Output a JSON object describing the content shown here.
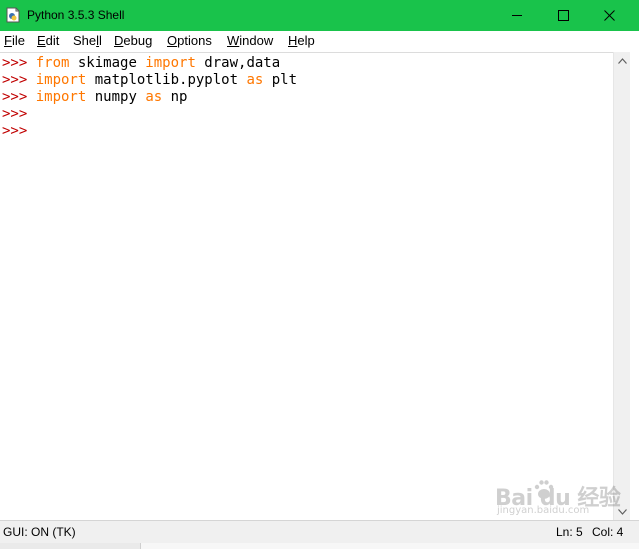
{
  "window": {
    "title": "Python 3.5.3 Shell",
    "titlebar_color": "#19c34b",
    "icon": "python-idle-icon",
    "controls": [
      "minimize-icon",
      "maximize-icon",
      "close-icon"
    ]
  },
  "menu": {
    "items": [
      {
        "ul": "F",
        "rest": "ile"
      },
      {
        "ul": "E",
        "rest": "dit"
      },
      {
        "ul": "",
        "pre": "She",
        "ulm": "l",
        "rest": "l"
      },
      {
        "ul": "D",
        "rest": "ebug"
      },
      {
        "ul": "O",
        "rest": "ptions"
      },
      {
        "ul": "W",
        "rest": "indow"
      },
      {
        "ul": "H",
        "rest": "elp"
      }
    ]
  },
  "editor": {
    "prompt": ">>> ",
    "prompt_color": "#c00000",
    "keyword_color": "#ff7700",
    "lines": [
      [
        {
          "t": "from",
          "k": true
        },
        {
          "t": " skimage ",
          "k": false
        },
        {
          "t": "import",
          "k": true
        },
        {
          "t": " draw,data",
          "k": false
        }
      ],
      [
        {
          "t": "import",
          "k": true
        },
        {
          "t": " matplotlib.pyplot ",
          "k": false
        },
        {
          "t": "as",
          "k": true
        },
        {
          "t": " plt",
          "k": false
        }
      ],
      [
        {
          "t": "import",
          "k": true
        },
        {
          "t": " numpy ",
          "k": false
        },
        {
          "t": "as",
          "k": true
        },
        {
          "t": " np",
          "k": false
        }
      ],
      [],
      []
    ]
  },
  "status": {
    "gui": "GUI: ON (TK)",
    "line": "Ln: 5",
    "col": "Col: 4"
  },
  "watermark": {
    "text": "Bai du 经验",
    "sub": "jingyan.baidu.com"
  }
}
